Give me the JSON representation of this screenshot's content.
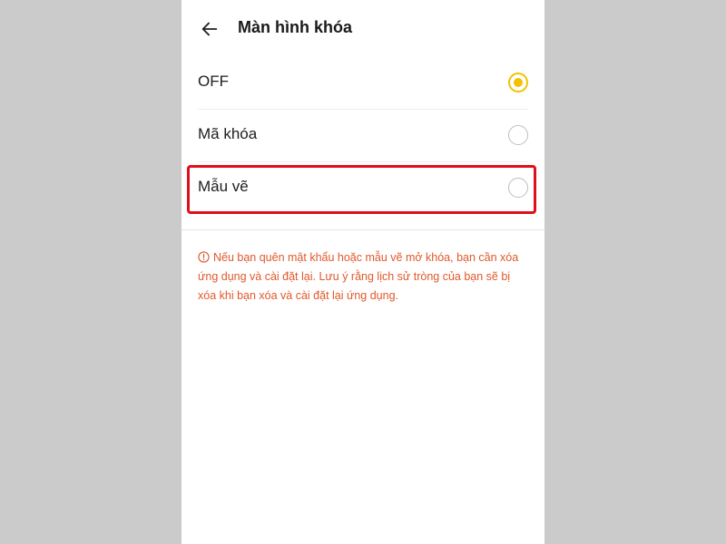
{
  "header": {
    "title": "Màn hình khóa",
    "back_icon": "arrow-left-icon"
  },
  "options": [
    {
      "label": "OFF",
      "selected": true
    },
    {
      "label": "Mã khóa",
      "selected": false
    },
    {
      "label": "Mẫu vẽ",
      "selected": false
    }
  ],
  "notice": {
    "icon": "info-circle-icon",
    "text": "Nếu bạn quên mật khẩu hoặc mẫu vẽ mở khóa, bạn cần xóa ứng dụng và cài đặt lại. Lưu ý rằng lịch sử tròng của bạn sẽ bị xóa khi bạn xóa và cài đặt lại ứng dụng."
  },
  "colors": {
    "accent": "#f2c200",
    "warning_text": "#e0582a",
    "highlight_box": "#e0101a",
    "backdrop": "#cbcbcb"
  }
}
